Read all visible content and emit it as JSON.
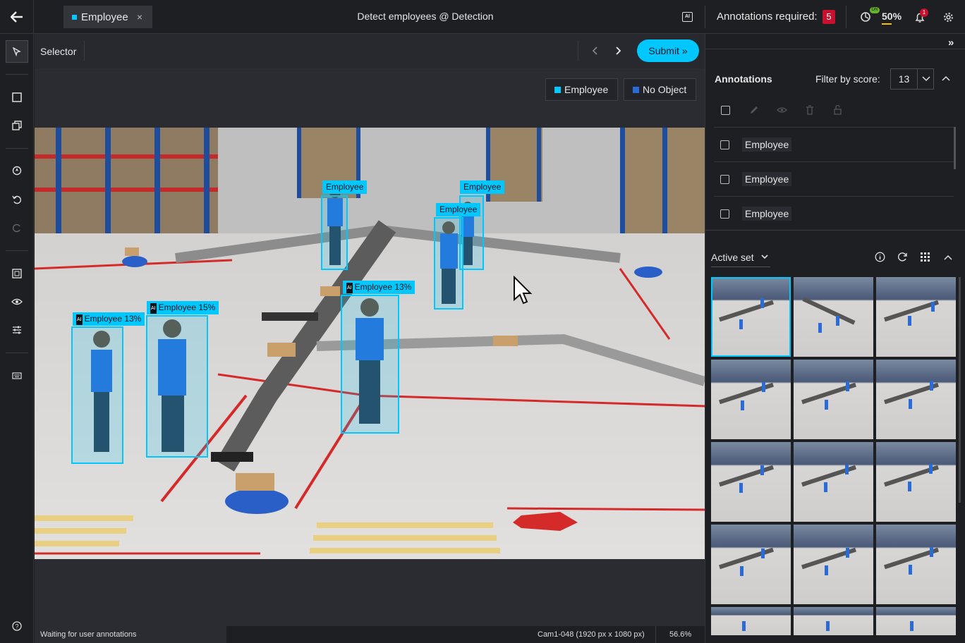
{
  "topbar": {
    "tab_label": "Employee",
    "tab_close": "×",
    "title": "Detect employees @ Detection",
    "annotations_required_label": "Annotations required:",
    "annotations_required_count": "5",
    "on_label": "ON",
    "progress": "50%",
    "notification_count": "1"
  },
  "subbar": {
    "tool_name": "Selector",
    "submit_label": "Submit »"
  },
  "labels_bar": [
    {
      "label": "Employee",
      "color": "#00c7fd"
    },
    {
      "label": "No Object",
      "color": "#2a6bd6"
    }
  ],
  "boxes": [
    {
      "label": "Employee",
      "ai": false
    },
    {
      "label": "Employee",
      "ai": false
    },
    {
      "label": "Employee",
      "ai": false
    },
    {
      "label": "Employee 13%",
      "ai": true
    },
    {
      "label": "Employee 15%",
      "ai": true
    },
    {
      "label": "Employee 13%",
      "ai": true
    }
  ],
  "status": {
    "message": "Waiting for user annotations",
    "media": "Cam1-048 (1920 px x 1080 px)",
    "zoom": "56.6%"
  },
  "right_panel": {
    "expand": "»",
    "annotations_title": "Annotations",
    "filter_label": "Filter by score:",
    "filter_value": "13",
    "annotation_items": [
      "Employee",
      "Employee",
      "Employee"
    ],
    "active_set_label": "Active set"
  },
  "colors": {
    "accent": "#00c7fd",
    "alert": "#c8102e"
  }
}
